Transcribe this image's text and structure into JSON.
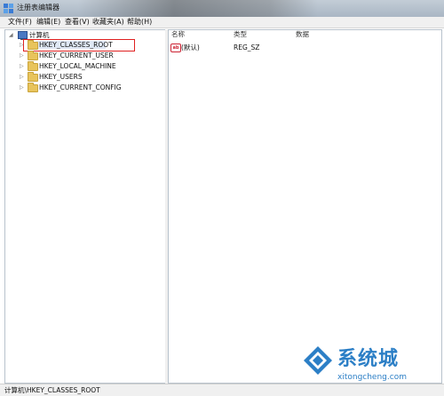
{
  "window": {
    "title": "注册表编辑器"
  },
  "menu": [
    "文件(F)",
    "编辑(E)",
    "查看(V)",
    "收藏夹(A)",
    "帮助(H)"
  ],
  "tree": {
    "root": "计算机",
    "hives": [
      "HKEY_CLASSES_ROOT",
      "HKEY_CURRENT_USER",
      "HKEY_LOCAL_MACHINE",
      "HKEY_USERS",
      "HKEY_CURRENT_CONFIG"
    ],
    "selected": "HKEY_CLASSES_ROOT"
  },
  "list": {
    "columns": [
      "名称",
      "类型",
      "数据"
    ],
    "rows": [
      {
        "name": "(默认)",
        "type": "REG_SZ",
        "data": ""
      }
    ]
  },
  "status": {
    "path": "计算机\\HKEY_CLASSES_ROOT"
  },
  "watermark": {
    "brand": "系统城",
    "site": "xitongcheng.com"
  },
  "colors": {
    "selection_outline": "#e02020",
    "watermark": "#2c7fc6",
    "folder": "#e8c45c"
  }
}
